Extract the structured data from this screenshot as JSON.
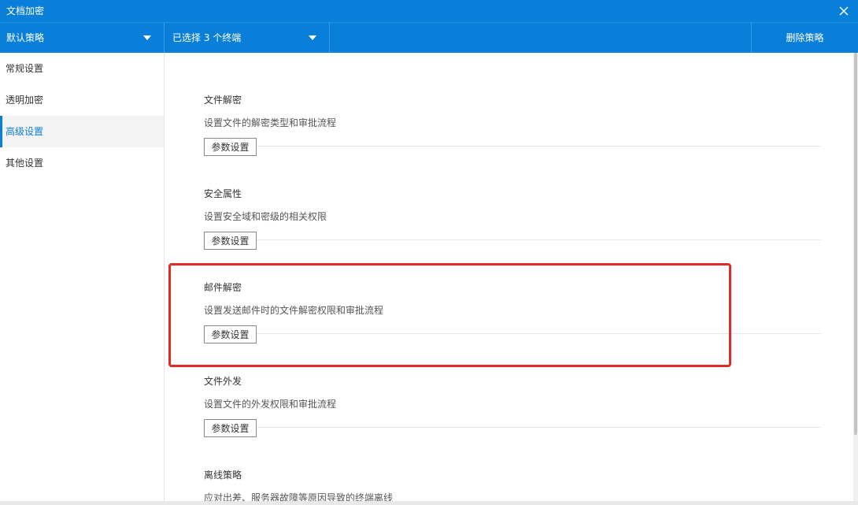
{
  "window": {
    "title": "文档加密"
  },
  "toolbar": {
    "policy_label": "默认策略",
    "terminals_label": "已选择 3 个终端",
    "delete_label": "删除策略"
  },
  "sidebar": {
    "items": [
      {
        "label": "常规设置",
        "active": false
      },
      {
        "label": "透明加密",
        "active": false
      },
      {
        "label": "高级设置",
        "active": true
      },
      {
        "label": "其他设置",
        "active": false
      }
    ]
  },
  "sections": [
    {
      "title": "文件解密",
      "desc": "设置文件的解密类型和审批流程",
      "button": "参数设置"
    },
    {
      "title": "安全属性",
      "desc": "设置安全域和密级的相关权限",
      "button": "参数设置"
    },
    {
      "title": "邮件解密",
      "desc": "设置发送邮件时的文件解密权限和审批流程",
      "button": "参数设置"
    },
    {
      "title": "文件外发",
      "desc": "设置文件的外发权限和审批流程",
      "button": "参数设置"
    },
    {
      "title": "离线策略",
      "desc": "应对出差、服务器故障等原因导致的终端离线"
    }
  ],
  "colors": {
    "accent": "#0a7fd9",
    "highlight": "#e02b2b"
  }
}
